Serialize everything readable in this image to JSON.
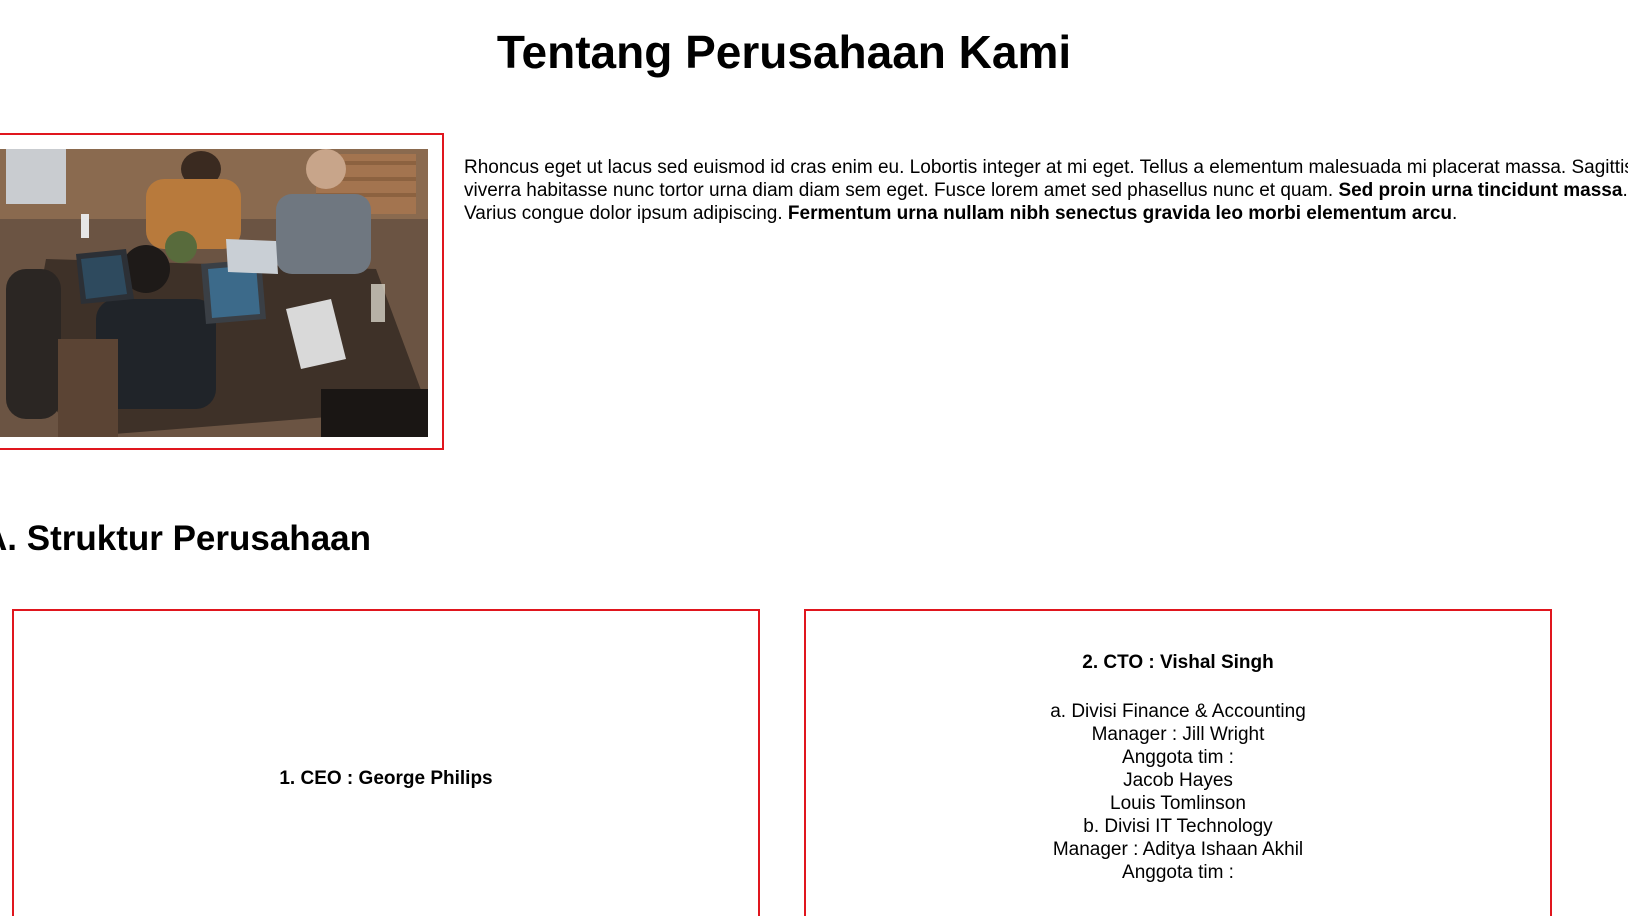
{
  "page": {
    "title": "Tentang Perusahaan Kami"
  },
  "intro": {
    "text_1": "Rhoncus eget ut lacus sed euismod id cras enim eu. Lobortis integer at mi eget. Tellus a elementum malesuada mi placerat massa. Sagittis viverra habitasse nunc tortor urna diam diam sem eget. Fusce lorem amet sed phasellus nunc et quam. ",
    "bold_1": "Sed proin urna tincidunt massa",
    "text_2": ". Varius congue dolor ipsum adipiscing. ",
    "bold_2": "Fermentum urna nullam nibh senectus gravida leo morbi elementum arcu",
    "text_3": "."
  },
  "section": {
    "title": "A. Struktur Perusahaan"
  },
  "cards": {
    "ceo": {
      "heading": "1. CEO : George Philips"
    },
    "cto": {
      "heading": "2. CTO : Vishal Singh",
      "lines": [
        "a. Divisi Finance & Accounting",
        "Manager : Jill Wright",
        "Anggota tim :",
        "Jacob Hayes",
        "Louis Tomlinson",
        "b. Divisi IT Technology",
        "Manager : Aditya Ishaan Akhil",
        "Anggota tim :"
      ]
    }
  },
  "colors": {
    "border_accent": "#e0161e"
  }
}
